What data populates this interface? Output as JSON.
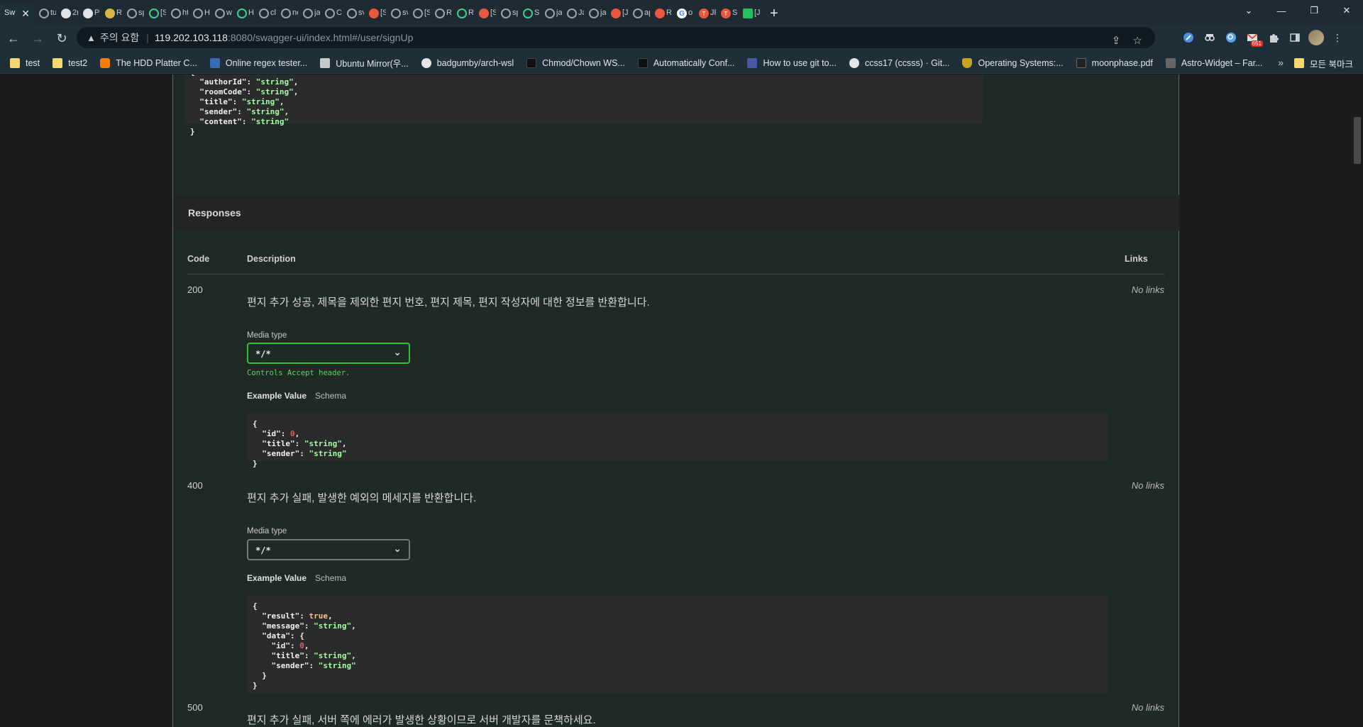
{
  "browser": {
    "active_tab": {
      "label": "Sw",
      "icon": "swagger-icon"
    },
    "tabs": [
      {
        "label": "tu",
        "icon": "globe-icon",
        "color": "plain"
      },
      {
        "label": "2r",
        "icon": "github-icon",
        "color": "gh"
      },
      {
        "label": "Pr",
        "icon": "github-icon",
        "color": "gh"
      },
      {
        "label": "Rl",
        "icon": "site-icon",
        "color": "yellow"
      },
      {
        "label": "sp",
        "icon": "globe-icon",
        "color": "plain"
      },
      {
        "label": "[S",
        "icon": "swagger-icon",
        "color": "green"
      },
      {
        "label": "ht",
        "icon": "globe-icon",
        "color": "plain"
      },
      {
        "label": "H",
        "icon": "globe-icon",
        "color": "plain"
      },
      {
        "label": "w",
        "icon": "globe-icon",
        "color": "plain"
      },
      {
        "label": "H",
        "icon": "swagger-icon",
        "color": "green"
      },
      {
        "label": "cl",
        "icon": "globe-icon",
        "color": "plain"
      },
      {
        "label": "ne",
        "icon": "globe-icon",
        "color": "plain"
      },
      {
        "label": "ja",
        "icon": "globe-icon",
        "color": "plain"
      },
      {
        "label": "C",
        "icon": "globe-icon",
        "color": "plain"
      },
      {
        "label": "sv",
        "icon": "globe-icon",
        "color": "plain"
      },
      {
        "label": "[S",
        "icon": "site-icon",
        "color": "red"
      },
      {
        "label": "sv",
        "icon": "globe-icon",
        "color": "plain"
      },
      {
        "label": "[S",
        "icon": "globe-icon",
        "color": "plain"
      },
      {
        "label": "R",
        "icon": "globe-icon",
        "color": "plain"
      },
      {
        "label": "R",
        "icon": "swagger-icon",
        "color": "green"
      },
      {
        "label": "[S",
        "icon": "site-icon",
        "color": "red"
      },
      {
        "label": "sp",
        "icon": "globe-icon",
        "color": "plain"
      },
      {
        "label": "Sp",
        "icon": "swagger-icon",
        "color": "green"
      },
      {
        "label": "ja",
        "icon": "globe-icon",
        "color": "plain"
      },
      {
        "label": "Ja",
        "icon": "globe-icon",
        "color": "plain"
      },
      {
        "label": "ja",
        "icon": "globe-icon",
        "color": "plain"
      },
      {
        "label": "[J",
        "icon": "site-icon",
        "color": "red"
      },
      {
        "label": "ap",
        "icon": "globe-icon",
        "color": "plain"
      },
      {
        "label": "R",
        "icon": "site-icon",
        "color": "red"
      },
      {
        "label": "o",
        "icon": "google-icon",
        "color": "google"
      },
      {
        "label": "JF",
        "icon": "tistory-icon",
        "color": "tt"
      },
      {
        "label": "Sp",
        "icon": "tistory-icon",
        "color": "tt"
      },
      {
        "label": "[J",
        "icon": "line-icon",
        "color": "line"
      }
    ],
    "new_tab": "+",
    "window_controls": {
      "dropdown": "⌄",
      "minimize": "—",
      "restore": "❐",
      "close": "✕"
    },
    "nav": {
      "back": "←",
      "forward": "→",
      "reload": "↻"
    },
    "omnibox": {
      "warning": "▲",
      "security_label": "주의 요함",
      "separator": "|",
      "host": "119.202.103.118",
      "rest": ":8080/swagger-ui/index.html#/user/signUp"
    },
    "omnibox_icons": {
      "share": "⇪",
      "star": "☆"
    },
    "extensions_badge": "651",
    "bookmarks": [
      {
        "label": "test",
        "icon": "folder"
      },
      {
        "label": "test2",
        "icon": "folder"
      },
      {
        "label": "The HDD Platter C...",
        "icon": "blogger"
      },
      {
        "label": "Online regex tester...",
        "icon": "r"
      },
      {
        "label": "Ubuntu Mirror(우...",
        "icon": "ubuntu"
      },
      {
        "label": "badgumby/arch-wsl",
        "icon": "gh"
      },
      {
        "label": "Chmod/Chown WS...",
        "icon": "dark"
      },
      {
        "label": "Automatically Conf...",
        "icon": "dark"
      },
      {
        "label": "How to use git to...",
        "icon": "nb"
      },
      {
        "label": "ccss17 (ccsss) · Git...",
        "icon": "gh"
      },
      {
        "label": "Operating Systems:...",
        "icon": "shield"
      },
      {
        "label": "moonphase.pdf",
        "icon": "pdf"
      },
      {
        "label": "Astro-Widget – Far...",
        "icon": "astro"
      }
    ],
    "bookmarks_more": "»",
    "all_bookmarks": "모든 북마크"
  },
  "request_example": {
    "lines": [
      {
        "t": "{"
      },
      {
        "t": "  \"authorId\"",
        "v": "\"string\"",
        "c": "s"
      },
      {
        "t": "  \"roomCode\"",
        "v": "\"string\"",
        "c": "s"
      },
      {
        "t": "  \"title\"",
        "v": "\"string\"",
        "c": "s"
      },
      {
        "t": "  \"sender\"",
        "v": "\"string\"",
        "c": "s"
      },
      {
        "t": "  \"content\"",
        "v": "\"string\"",
        "c": "s",
        "last": true
      },
      {
        "t": "}"
      }
    ]
  },
  "responses": {
    "section_title": "Responses",
    "headers": {
      "code": "Code",
      "description": "Description",
      "links": "Links"
    },
    "media_type_label": "Media type",
    "accept_note": "Controls Accept header.",
    "example_value_tab": "Example Value",
    "schema_tab": "Schema",
    "items": [
      {
        "code": "200",
        "description": "편지 추가 성공, 제목을 제외한 편지 번호, 편지 제목, 편지 작성자에 대한 정보를 반환합니다.",
        "links": "No links",
        "media_type": "*/*"
      },
      {
        "code": "400",
        "description": "편지 추가 실패, 발생한 예외의 메세지를 반환합니다.",
        "links": "No links",
        "media_type": "*/*"
      },
      {
        "code": "500",
        "description": "편지 추가 실패, 서버 쪽에 에러가 발생한 상황이므로 서버 개발자를 문책하세요.",
        "links": "No links"
      }
    ]
  },
  "colors": {
    "panel_border": "#3b7e5f",
    "string_value": "#a2fca2",
    "number_value": "#d36363",
    "boolean_value": "#fcc28c",
    "focus_border": "#2ec32e",
    "accept_note": "#5fd05f"
  }
}
